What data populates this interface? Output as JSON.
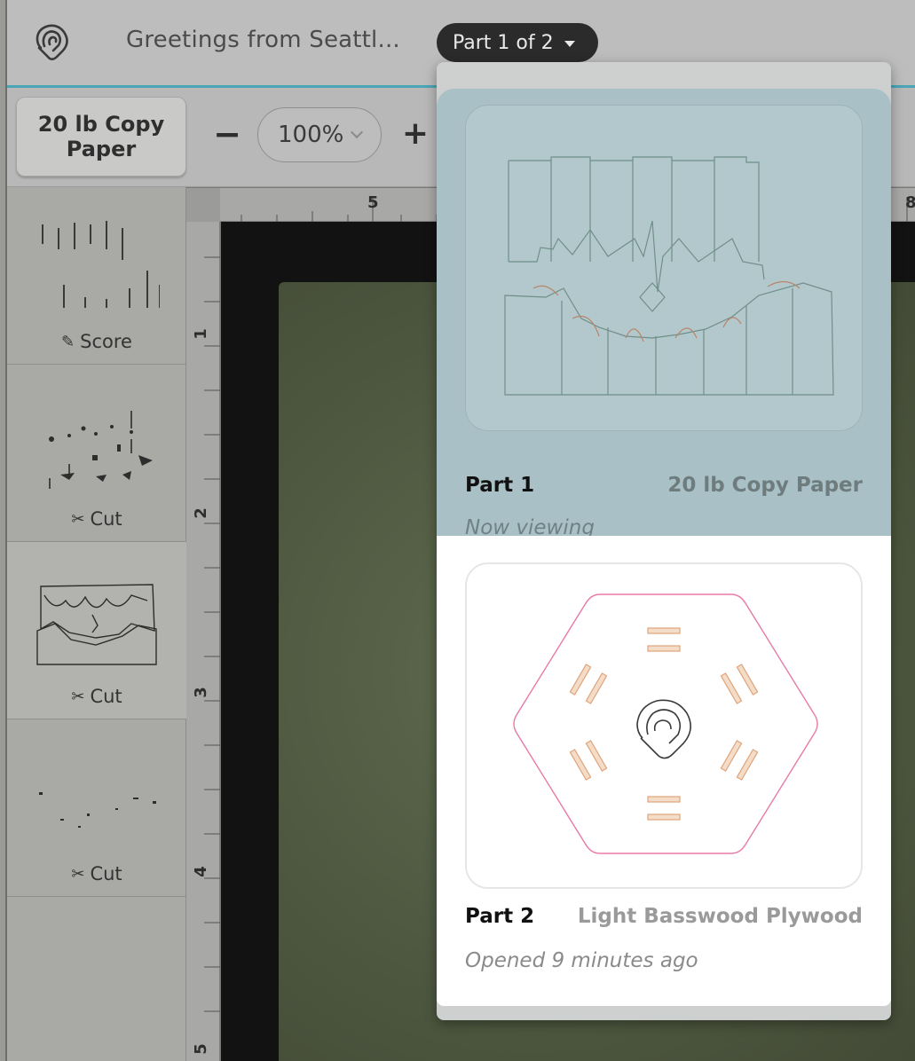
{
  "header": {
    "doc_title": "Greetings from Seattl...",
    "part_selector": "Part 1 of 2"
  },
  "toolbar": {
    "material_label": "20 lb Copy Paper",
    "zoom_value": "100%",
    "zoom_minus": "−",
    "zoom_plus": "+"
  },
  "steps": [
    {
      "label": "Score",
      "icon": "pencil-icon"
    },
    {
      "label": "Cut",
      "icon": "scissors-icon"
    },
    {
      "label": "Cut",
      "icon": "scissors-icon"
    },
    {
      "label": "Cut",
      "icon": "scissors-icon"
    }
  ],
  "rulers": {
    "top": [
      "5",
      "8"
    ],
    "left": [
      "1",
      "2",
      "3",
      "4",
      "5"
    ]
  },
  "parts": [
    {
      "name": "Part 1",
      "material": "20 lb Copy Paper",
      "status": "Now viewing"
    },
    {
      "name": "Part 2",
      "material": "Light Basswood Plywood",
      "status": "Opened 9 minutes ago"
    }
  ],
  "colors": {
    "accent": "#4aa6b6",
    "selected_part_bg": "#a9c1c6",
    "cut_line": "#e87aa8",
    "engrave_line": "#e0a47a"
  }
}
